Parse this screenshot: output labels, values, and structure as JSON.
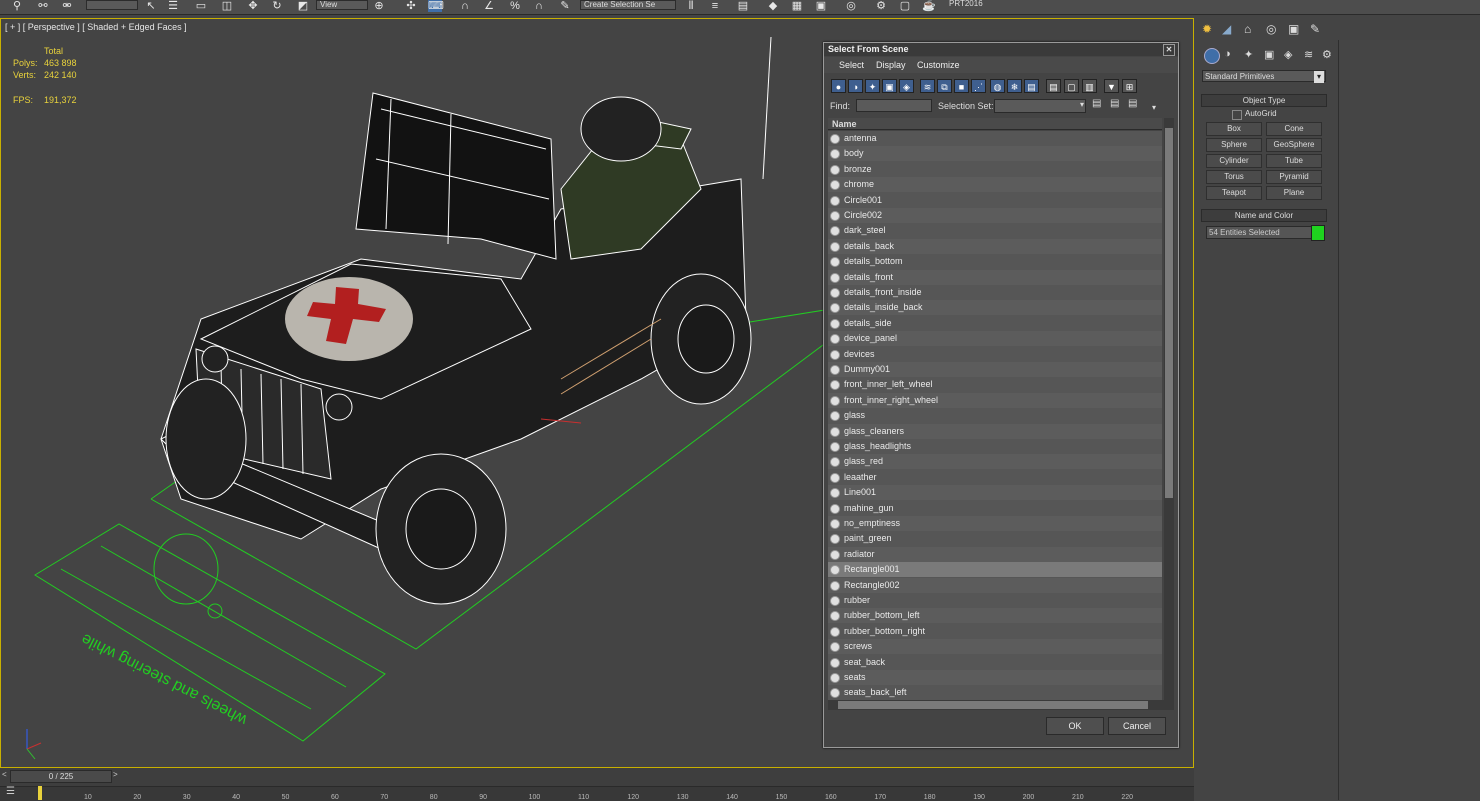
{
  "toolbar": {
    "combo_view": "View",
    "combo_selset": "Create Selection Se",
    "workspace": "PRT2016"
  },
  "viewport": {
    "label": "[ + ] [ Perspective ] [ Shaded + Edged Faces ]",
    "stats_header": "Total",
    "polys_label": "Polys:",
    "polys_value": "463 898",
    "verts_label": "Verts:",
    "verts_value": "242 140",
    "fps_label": "FPS:",
    "fps_value": "191,372",
    "ground_text": "wheels and steering while"
  },
  "dialog": {
    "title": "Select From Scene",
    "menu": [
      "Select",
      "Display",
      "Customize"
    ],
    "find_label": "Find:",
    "selection_set_label": "Selection Set:",
    "column_name": "Name",
    "items": [
      "antenna",
      "body",
      "bronze",
      "chrome",
      "Circle001",
      "Circle002",
      "dark_steel",
      "details_back",
      "details_bottom",
      "details_front",
      "details_front_inside",
      "details_inside_back",
      "details_side",
      "device_panel",
      "devices",
      "Dummy001",
      "front_inner_left_wheel",
      "front_inner_right_wheel",
      "glass",
      "glass_cleaners",
      "glass_headlights",
      "glass_red",
      "leaather",
      "Line001",
      "mahine_gun",
      "no_emptiness",
      "paint_green",
      "radiator",
      "Rectangle001",
      "Rectangle002",
      "rubber",
      "rubber_bottom_left",
      "rubber_bottom_right",
      "screws",
      "seat_back",
      "seats",
      "seats_back_left"
    ],
    "highlighted_item": "Rectangle001",
    "ok_label": "OK",
    "cancel_label": "Cancel"
  },
  "command_panel": {
    "category": "Standard Primitives",
    "object_type_title": "Object Type",
    "autogrid_label": "AutoGrid",
    "primitives": [
      "Box",
      "Cone",
      "Sphere",
      "GeoSphere",
      "Cylinder",
      "Tube",
      "Torus",
      "Pyramid",
      "Teapot",
      "Plane"
    ],
    "name_color_title": "Name and Color",
    "name_field": "54 Entities Selected",
    "color_swatch": "#1fd31f"
  },
  "timeline": {
    "frame_counter": "0 / 225",
    "ticks": [
      "10",
      "20",
      "30",
      "40",
      "50",
      "60",
      "70",
      "80",
      "90",
      "100",
      "110",
      "120",
      "130",
      "140",
      "150",
      "160",
      "170",
      "180",
      "190",
      "200",
      "210",
      "220"
    ]
  },
  "colors": {
    "accent_yellow": "#c8b000",
    "wire": "#ffffff",
    "grid_green": "#22cc22",
    "stats": "#e8d23c"
  }
}
